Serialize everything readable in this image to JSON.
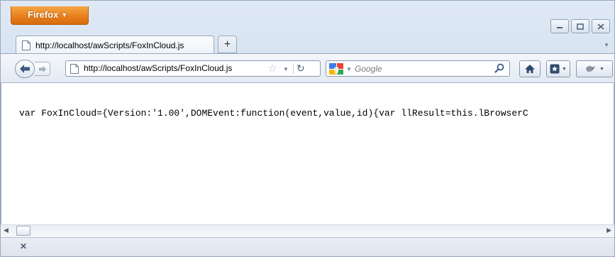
{
  "window": {
    "app_button_label": "Firefox"
  },
  "tabs": [
    {
      "label": "http://localhost/awScripts/FoxInCloud.js"
    }
  ],
  "toolbar": {
    "new_tab_label": "+",
    "url": "http://localhost/awScripts/FoxInCloud.js",
    "search_placeholder": "Google"
  },
  "content": {
    "code_text": "var FoxInCloud={Version:'1.00',DOMEvent:function(event,value,id){var llResult=this.lBrowserC"
  },
  "icons": {
    "app_menu": "chevron-down-icon",
    "window_minimize": "minimize-icon",
    "window_maximize": "maximize-icon",
    "window_close": "close-icon",
    "back": "back-arrow-icon",
    "forward": "forward-arrow-icon",
    "bookmark_star": "star-icon",
    "reload": "reload-icon",
    "search_engine": "google-icon",
    "search_go": "magnifier-icon",
    "home": "home-icon",
    "bookmarks": "bookmarks-icon",
    "addon": "puzzle-icon",
    "addon_bar_close": "close-icon"
  },
  "colors": {
    "firefox_button": "#e8801c",
    "chrome_bg": "#d5e1f0"
  }
}
